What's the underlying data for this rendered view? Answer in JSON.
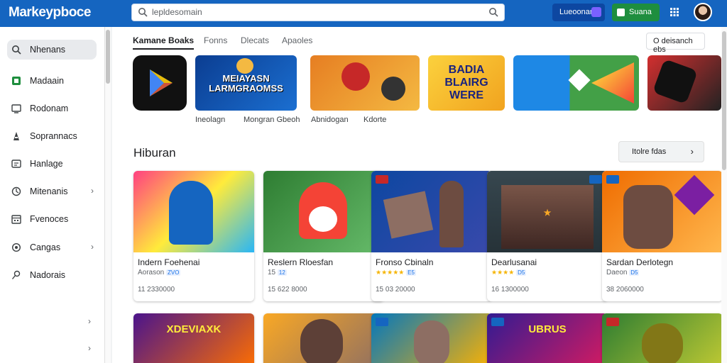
{
  "app": {
    "brand": "Markeypboce"
  },
  "search": {
    "value": "lepldesomain"
  },
  "topbar": {
    "account_label": "Lueoonan",
    "green_label": "Suana"
  },
  "sidebar": {
    "items": [
      {
        "label": "Nhenans",
        "icon": "search-icon"
      },
      {
        "label": "Madaain",
        "icon": "app-icon"
      },
      {
        "label": "Rodonam",
        "icon": "tv-icon"
      },
      {
        "label": "Soprannacs",
        "icon": "book-icon"
      },
      {
        "label": "Hanlage",
        "icon": "device-icon"
      },
      {
        "label": "Mitenanis",
        "icon": "kids-icon"
      },
      {
        "label": "Fvenoces",
        "icon": "calendar-icon"
      },
      {
        "label": "Cangas",
        "icon": "settings-icon"
      },
      {
        "label": "Nadorais",
        "icon": "pin-icon"
      }
    ]
  },
  "main": {
    "tabs": [
      "Kamane Boaks",
      "Fonns",
      "Dlecats",
      "Apaoles"
    ],
    "top_button": "O deisanch ebs",
    "featured": [
      {
        "label": "Ineolagn",
        "colors": [
          "#111111",
          "#111111"
        ]
      },
      {
        "label": "Mongran Gbeoh",
        "title": "MEIAYASN LARMGRAOMSS",
        "colors": [
          "#0b3d91",
          "#1b6fd1"
        ]
      },
      {
        "label": "Abnidogan",
        "colors": [
          "#e67e22",
          "#f4b942"
        ]
      },
      {
        "label": "Kdorte",
        "title": "BADIA BLAIRG WERE",
        "colors": [
          "#fbd13d",
          "#f1a31f"
        ]
      },
      {
        "label": "",
        "colors": [
          "#1e88e5",
          "#43a047"
        ]
      },
      {
        "label": "",
        "colors": [
          "#d32f2f",
          "#222222"
        ]
      }
    ],
    "section": {
      "title": "Hiburan",
      "button": "Itolre fdas",
      "cards": [
        {
          "name": "Indern Foehenai",
          "sub": "Aorason",
          "badge": "ZVO",
          "price": "11 2330000",
          "stars": "",
          "colors": [
            "#ff4081",
            "#29b6f6"
          ]
        },
        {
          "name": "Reslern Rloesfan",
          "sub": "15",
          "badge": "12",
          "price": "15 622 8000",
          "stars": "",
          "colors": [
            "#2e7d32",
            "#f44336"
          ]
        },
        {
          "name": "Fronso Cbinaln",
          "sub": "",
          "badge": "E5",
          "price": "15 03 20000",
          "stars": "★★★★★",
          "colors": [
            "#0d47a1",
            "#3949ab"
          ]
        },
        {
          "name": "Dearlusanai",
          "sub": "",
          "badge": "D5",
          "price": "16 1300000",
          "stars": "★★★★",
          "colors": [
            "#263238",
            "#f9a825"
          ]
        },
        {
          "name": "Sardan Derlotegn",
          "sub": "Daeon",
          "badge": "D5",
          "price": "38 2060000",
          "stars": "",
          "colors": [
            "#ef6c00",
            "#6d4c41"
          ]
        }
      ],
      "row2": [
        {
          "title": "XDEVIAXK",
          "colors": [
            "#4a148c",
            "#ff6f00"
          ]
        },
        {
          "title": "",
          "colors": [
            "#f9a825",
            "#8d6e63"
          ]
        },
        {
          "title": "",
          "colors": [
            "#0277bd",
            "#ffb300"
          ]
        },
        {
          "title": "UBRUS",
          "colors": [
            "#311b92",
            "#d81b60"
          ]
        },
        {
          "title": "",
          "colors": [
            "#2e7d32",
            "#c0ca33"
          ]
        }
      ]
    }
  },
  "colors": {
    "topbar": "#1565c0",
    "accent_green": "#1e8e3e"
  }
}
